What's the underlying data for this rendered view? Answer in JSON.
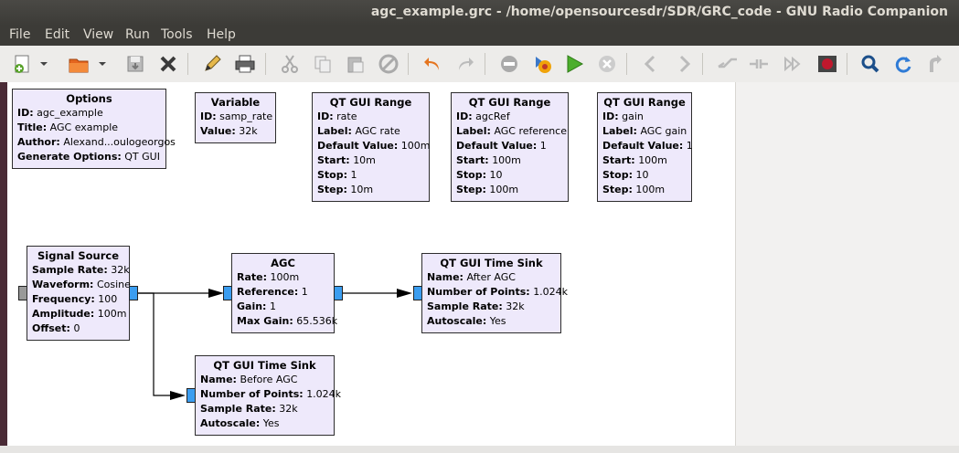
{
  "window": {
    "title": "agc_example.grc - /home/opensourcesdr/SDR/GRC_code - GNU Radio Companion"
  },
  "menu": [
    "File",
    "Edit",
    "View",
    "Run",
    "Tools",
    "Help"
  ],
  "toolbar_icons": [
    "new-icon",
    "new-dropdown-icon",
    "open-icon",
    "open-dropdown-icon",
    "save-icon",
    "close-icon",
    "edit-icon",
    "print-icon",
    "cut-icon",
    "copy-icon",
    "paste-icon",
    "delete-icon",
    "undo-icon",
    "redo-icon",
    "disable-icon",
    "generate-icon",
    "run-icon",
    "kill-icon",
    "rotate-ccw-icon",
    "rotate-cw-icon",
    "enable-icon",
    "bypass-icon",
    "forward-icon",
    "stop-record-icon",
    "search-icon",
    "reload-icon",
    "redo2-icon"
  ],
  "blocks": {
    "options": {
      "title": "Options",
      "rows": [
        {
          "k": "ID:",
          "v": "agc_example"
        },
        {
          "k": "Title:",
          "v": "AGC example"
        },
        {
          "k": "Author:",
          "v": "Alexand...oulogeorgos"
        },
        {
          "k": "Generate Options:",
          "v": "QT GUI"
        }
      ]
    },
    "variable": {
      "title": "Variable",
      "rows": [
        {
          "k": "ID:",
          "v": "samp_rate"
        },
        {
          "k": "Value:",
          "v": "32k"
        }
      ]
    },
    "range_rate": {
      "title": "QT GUI Range",
      "rows": [
        {
          "k": "ID:",
          "v": "rate"
        },
        {
          "k": "Label:",
          "v": "AGC rate"
        },
        {
          "k": "Default Value:",
          "v": "100m"
        },
        {
          "k": "Start:",
          "v": "10m"
        },
        {
          "k": "Stop:",
          "v": "1"
        },
        {
          "k": "Step:",
          "v": "10m"
        }
      ]
    },
    "range_ref": {
      "title": "QT GUI Range",
      "rows": [
        {
          "k": "ID:",
          "v": "agcRef"
        },
        {
          "k": "Label:",
          "v": "AGC reference"
        },
        {
          "k": "Default Value:",
          "v": "1"
        },
        {
          "k": "Start:",
          "v": "100m"
        },
        {
          "k": "Stop:",
          "v": "10"
        },
        {
          "k": "Step:",
          "v": "100m"
        }
      ]
    },
    "range_gain": {
      "title": "QT GUI Range",
      "rows": [
        {
          "k": "ID:",
          "v": "gain"
        },
        {
          "k": "Label:",
          "v": "AGC gain"
        },
        {
          "k": "Default Value:",
          "v": "1"
        },
        {
          "k": "Start:",
          "v": "100m"
        },
        {
          "k": "Stop:",
          "v": "10"
        },
        {
          "k": "Step:",
          "v": "100m"
        }
      ]
    },
    "signal_source": {
      "title": "Signal Source",
      "rows": [
        {
          "k": "Sample Rate:",
          "v": "32k"
        },
        {
          "k": "Waveform:",
          "v": "Cosine"
        },
        {
          "k": "Frequency:",
          "v": "100"
        },
        {
          "k": "Amplitude:",
          "v": "100m"
        },
        {
          "k": "Offset:",
          "v": "0"
        }
      ]
    },
    "agc": {
      "title": "AGC",
      "rows": [
        {
          "k": "Rate:",
          "v": "100m"
        },
        {
          "k": "Reference:",
          "v": "1"
        },
        {
          "k": "Gain:",
          "v": "1"
        },
        {
          "k": "Max Gain:",
          "v": "65.536k"
        }
      ]
    },
    "sink_after": {
      "title": "QT GUI Time Sink",
      "rows": [
        {
          "k": "Name:",
          "v": "After AGC"
        },
        {
          "k": "Number of Points:",
          "v": "1.024k"
        },
        {
          "k": "Sample Rate:",
          "v": "32k"
        },
        {
          "k": "Autoscale:",
          "v": "Yes"
        }
      ]
    },
    "sink_before": {
      "title": "QT GUI Time Sink",
      "rows": [
        {
          "k": "Name:",
          "v": "Before AGC"
        },
        {
          "k": "Number of Points:",
          "v": "1.024k"
        },
        {
          "k": "Sample Rate:",
          "v": "32k"
        },
        {
          "k": "Autoscale:",
          "v": "Yes"
        }
      ]
    }
  }
}
